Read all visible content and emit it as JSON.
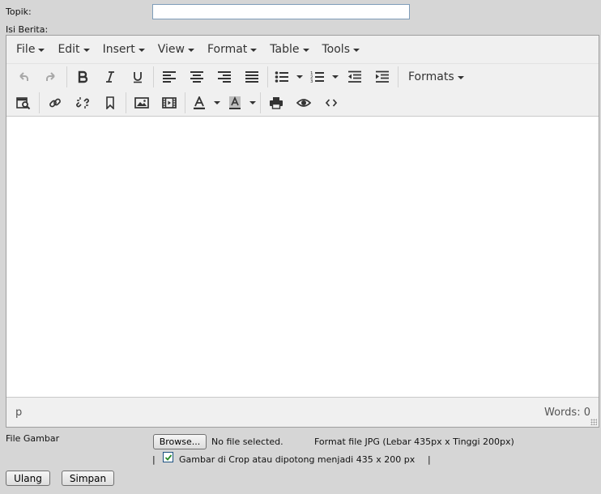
{
  "form": {
    "topik_label": "Topik:",
    "topik_value": "",
    "isi_label": "Isi Berita:",
    "file_label": "File Gambar",
    "browse_label": "Browse...",
    "no_file_text": "No file selected.",
    "format_hint": "Format file JPG (Lebar 435px x Tinggi 200px)",
    "crop_pipe_left": "|",
    "crop_label": "Gambar di Crop atau dipotong menjadi 435 x 200 px",
    "crop_pipe_right": "|",
    "crop_checked": true,
    "reset_label": "Ulang",
    "submit_label": "Simpan"
  },
  "editor": {
    "menus": [
      {
        "label": "File"
      },
      {
        "label": "Edit"
      },
      {
        "label": "Insert"
      },
      {
        "label": "View"
      },
      {
        "label": "Format"
      },
      {
        "label": "Table"
      },
      {
        "label": "Tools"
      }
    ],
    "formats_label": "Formats",
    "status_path": "p",
    "word_count": "Words: 0",
    "icons": [
      "undo-icon",
      "redo-icon",
      "bold-icon",
      "italic-icon",
      "underline-icon",
      "align-left-icon",
      "align-center-icon",
      "align-right-icon",
      "align-justify-icon",
      "bullet-list-icon",
      "numbered-list-icon",
      "outdent-icon",
      "indent-icon",
      "search-replace-icon",
      "link-icon",
      "unlink-icon",
      "bookmark-icon",
      "image-icon",
      "media-icon",
      "text-color-icon",
      "background-color-icon",
      "print-icon",
      "preview-icon",
      "source-code-icon"
    ],
    "colors": {
      "toolbar_bg": "#f0f0f0",
      "icon": "#333333",
      "disabled_icon": "#a8a8a8",
      "page_bg": "#d6d6d6"
    }
  }
}
